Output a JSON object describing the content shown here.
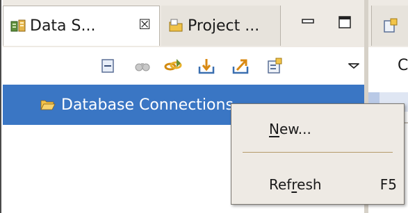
{
  "view": {
    "tabs": [
      {
        "label": "Data S...",
        "icon": "data-source-explorer-icon",
        "active": true,
        "close_glyph": "☒"
      },
      {
        "label": "Project ...",
        "icon": "project-explorer-icon",
        "active": false
      }
    ],
    "window_buttons": [
      "minimize-icon",
      "maximize-icon"
    ]
  },
  "toolbar": {
    "buttons": [
      "collapse-all-icon",
      "filter-icon",
      "link-with-editor-icon",
      "import-icon",
      "export-icon",
      "properties-icon",
      "view-menu-icon"
    ]
  },
  "tree": {
    "items": [
      {
        "label": "Database Connections",
        "icon": "folder-open-icon",
        "selected": true
      }
    ]
  },
  "right_view": {
    "partial_text": "C"
  },
  "context_menu": {
    "items": [
      {
        "label_pre": "",
        "mnemonic": "N",
        "label_post": "ew...",
        "accelerator": ""
      },
      {
        "label_pre": "Ref",
        "mnemonic": "r",
        "label_post": "esh",
        "accelerator": "F5"
      }
    ]
  },
  "colors": {
    "selection": "#3a76c4",
    "menu_background": "#eeeae4",
    "separator": "#b49b69"
  }
}
